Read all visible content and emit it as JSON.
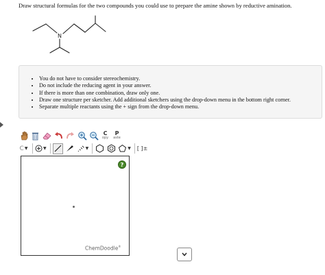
{
  "question": {
    "text": "Draw structural formulas for the two compounds you could use to prepare the amine shown by reductive amination."
  },
  "molecule": {
    "atom_label": "N"
  },
  "instructions": {
    "items": [
      "You do not have to consider stereochemistry.",
      "Do not include the reducing agent in your answer.",
      "If there is more than one combination, draw only one.",
      "Draw one structure per sketcher. Add additional sketchers using the drop-down menu in the bottom right corner.",
      "Separate multiple reactants using the + sign from the drop-down menu."
    ]
  },
  "toolbar": {
    "copy_top": "C",
    "copy_bottom": "opy",
    "paste_top": "P",
    "paste_bottom": "aste",
    "atom_label": "C",
    "bracket_label": "[ ]±"
  },
  "canvas": {
    "help_label": "?",
    "brand": "ChemDoodle",
    "brand_mark": "®"
  }
}
